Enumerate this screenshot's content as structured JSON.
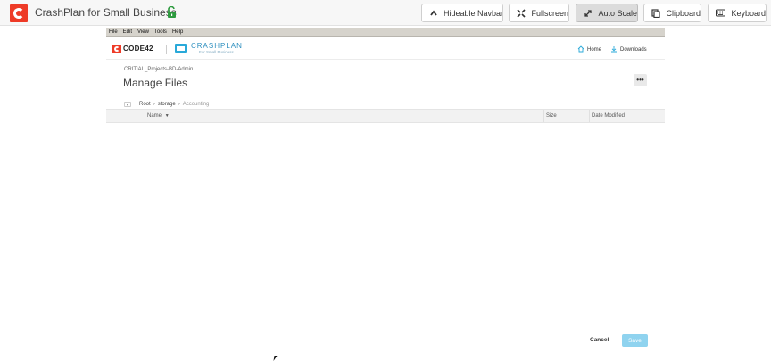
{
  "navbar": {
    "title": "CrashPlan for Small Business",
    "buttons": [
      {
        "label": "Hideable Navbar",
        "icon": "chevron-up-icon"
      },
      {
        "label": "Fullscreen",
        "icon": "fullscreen-icon"
      },
      {
        "label": "Auto Scale",
        "icon": "resize-icon"
      },
      {
        "label": "Clipboard",
        "icon": "clipboard-icon"
      },
      {
        "label": "Keyboard",
        "icon": "keyboard-icon"
      }
    ]
  },
  "app": {
    "menu": [
      "File",
      "Edit",
      "View",
      "Tools",
      "Help"
    ],
    "brand": {
      "code42": "CODE42",
      "crashplan": "CRASHPLAN",
      "crashplan_sub": "For Small Business"
    },
    "top_links": {
      "home": "Home",
      "downloads": "Downloads"
    },
    "device_name": "CRITIAL_Projects-BD-Admin",
    "page_title": "Manage Files",
    "more_label": "•••",
    "breadcrumb": [
      "Root",
      "storage",
      "Accounting"
    ],
    "table": {
      "columns": [
        "Name",
        "Size",
        "Date Modified"
      ]
    },
    "actions": {
      "cancel": "Cancel",
      "save": "Save"
    }
  },
  "colors": {
    "brand_red": "#ee3b27",
    "crashplan_blue": "#29a9d9",
    "save_disabled": "#8fd3ef"
  }
}
